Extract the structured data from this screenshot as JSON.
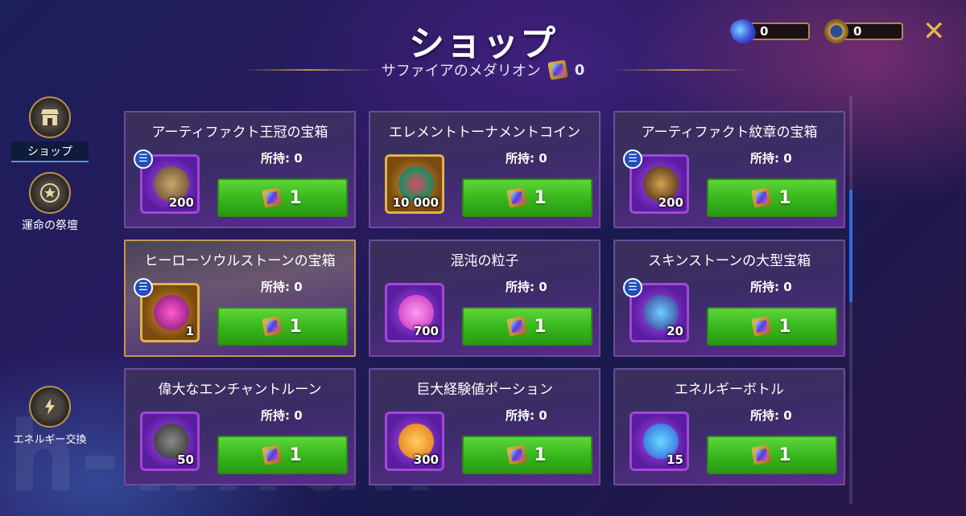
{
  "header": {
    "title": "ショップ",
    "subtitle": "サファイアのメダリオン",
    "medallion_count": "0",
    "close_icon": "close-icon"
  },
  "resources": [
    {
      "icon": "energy-gem-icon",
      "value": "0"
    },
    {
      "icon": "star-badge-icon",
      "value": "0"
    }
  ],
  "sidebar": [
    {
      "label": "ショップ",
      "icon": "shop-icon",
      "active": true
    },
    {
      "label": "運命の祭壇",
      "icon": "star-altar-icon",
      "active": false
    },
    {
      "label": "エネルギー交換",
      "icon": "energy-exchange-icon",
      "active": false
    }
  ],
  "owned_label": "所持: ",
  "items": [
    {
      "name": "アーティファクト王冠の宝箱",
      "owned": "0",
      "qty": "200",
      "price": "1",
      "info": true,
      "frame": "purple"
    },
    {
      "name": "エレメントトーナメントコイン",
      "owned": "0",
      "qty": "10 000",
      "price": "1",
      "info": false,
      "frame": "gold"
    },
    {
      "name": "アーティファクト紋章の宝箱",
      "owned": "0",
      "qty": "200",
      "price": "1",
      "info": true,
      "frame": "purple"
    },
    {
      "name": "ヒーローソウルストーンの宝箱",
      "owned": "0",
      "qty": "1",
      "price": "1",
      "info": true,
      "frame": "gold"
    },
    {
      "name": "混沌の粒子",
      "owned": "0",
      "qty": "700",
      "price": "1",
      "info": false,
      "frame": "purple"
    },
    {
      "name": "スキンストーンの大型宝箱",
      "owned": "0",
      "qty": "20",
      "price": "1",
      "info": true,
      "frame": "purple"
    },
    {
      "name": "偉大なエンチャントルーン",
      "owned": "0",
      "qty": "50",
      "price": "1",
      "info": false,
      "frame": "purple"
    },
    {
      "name": "巨大経験値ポーション",
      "owned": "0",
      "qty": "300",
      "price": "1",
      "info": false,
      "frame": "purple"
    },
    {
      "name": "エネルギーボトル",
      "owned": "0",
      "qty": "15",
      "price": "1",
      "info": false,
      "frame": "purple"
    }
  ],
  "watermark": "h-w.fun",
  "colors": {
    "buy_green": "#36b51c",
    "frame_purple": "#a347d8",
    "frame_gold": "#e3b24b",
    "accent_gold": "#e6b651"
  }
}
